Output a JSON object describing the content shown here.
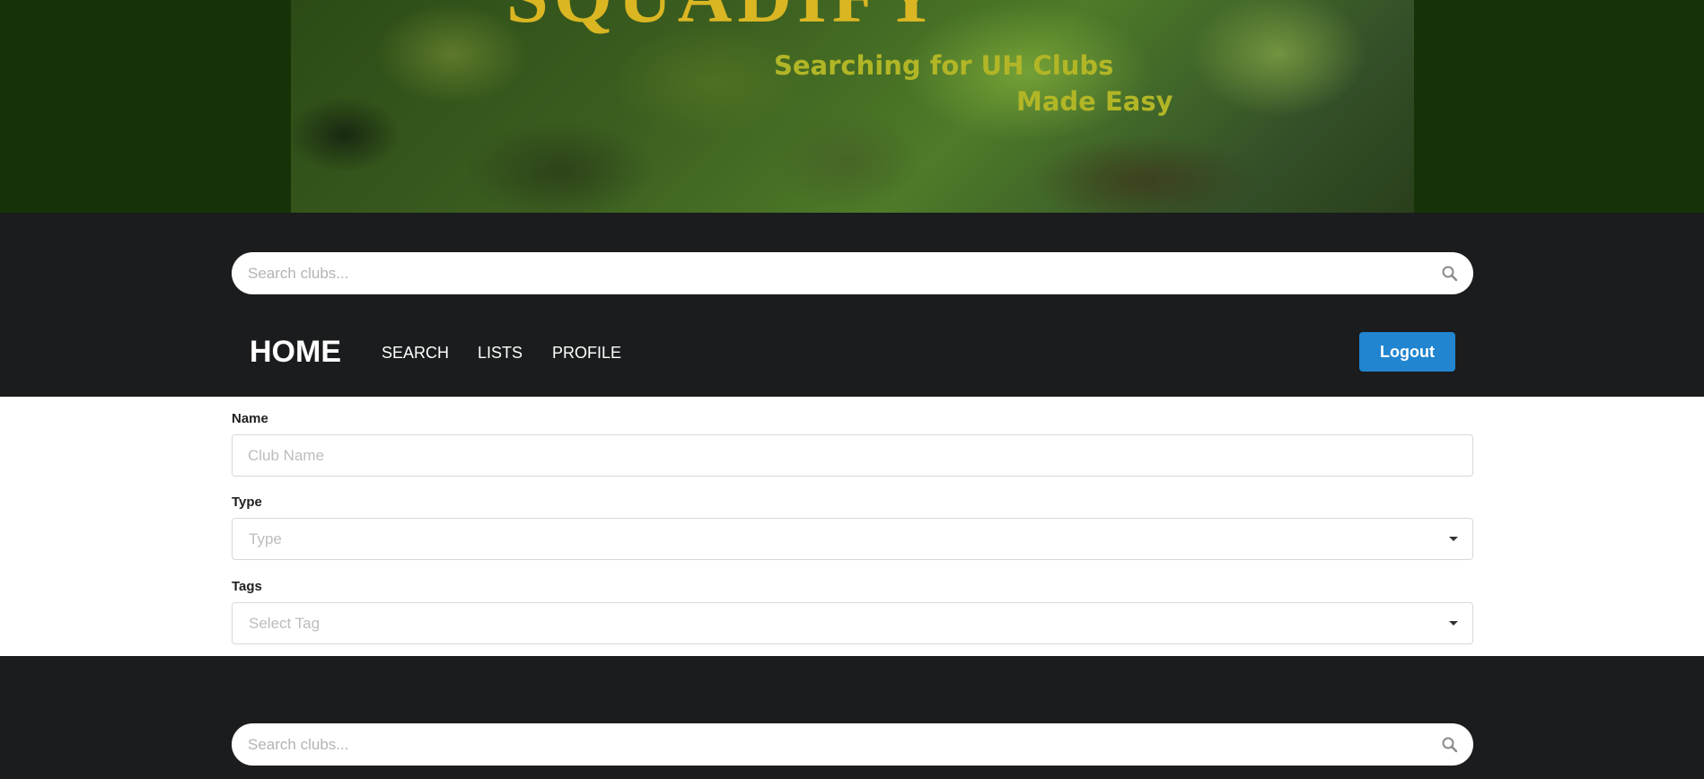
{
  "banner": {
    "logo_text": "SQUADIFY",
    "tagline_line1": "Searching for UH Clubs",
    "tagline_line2": "Made Easy"
  },
  "top_search": {
    "placeholder": "Search clubs...",
    "icon": "search-icon"
  },
  "nav": {
    "home_label": "HOME",
    "items": [
      {
        "label": "SEARCH"
      },
      {
        "label": "LISTS"
      },
      {
        "label": "PROFILE"
      }
    ],
    "logout_label": "Logout"
  },
  "form": {
    "name": {
      "label": "Name",
      "placeholder": "Club Name"
    },
    "type": {
      "label": "Type",
      "placeholder": "Type",
      "icon": "dropdown-icon"
    },
    "tags": {
      "label": "Tags",
      "placeholder": "Select Tag",
      "icon": "dropdown-icon"
    }
  },
  "bottom_search": {
    "placeholder": "Search clubs...",
    "icon": "search-icon"
  },
  "colors": {
    "banner_bg": "#163307",
    "dark_bg": "#1b1c1d",
    "logo_gold": "#d8b62a",
    "tagline": "#b2b52c",
    "logout_blue": "#2185d0"
  }
}
